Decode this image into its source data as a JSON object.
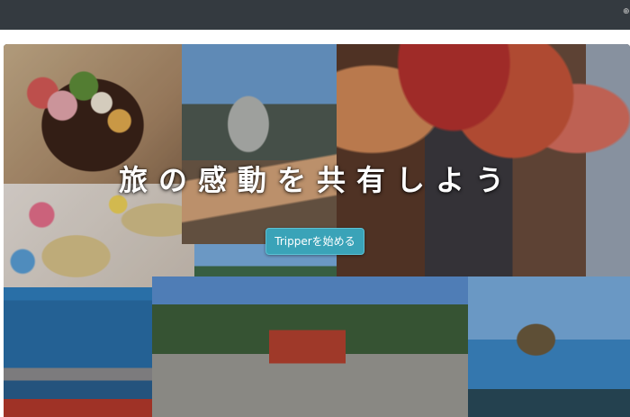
{
  "navbar": {
    "edge_glyph": "⊕",
    "background": "#343a40"
  },
  "hero": {
    "title": "旅の感動を共有しよう",
    "button_label": "Tripperを始める",
    "button_color": "#3aa3b8",
    "collage_icons": [
      "sushi-bowl-photo",
      "straw-hats-photo",
      "soft-serve-ice-cream-photo",
      "red-umbrellas-photo",
      "fountain-photo",
      "paddleboard-sea-photo",
      "shrine-photo",
      "cliff-swing-photo"
    ]
  }
}
